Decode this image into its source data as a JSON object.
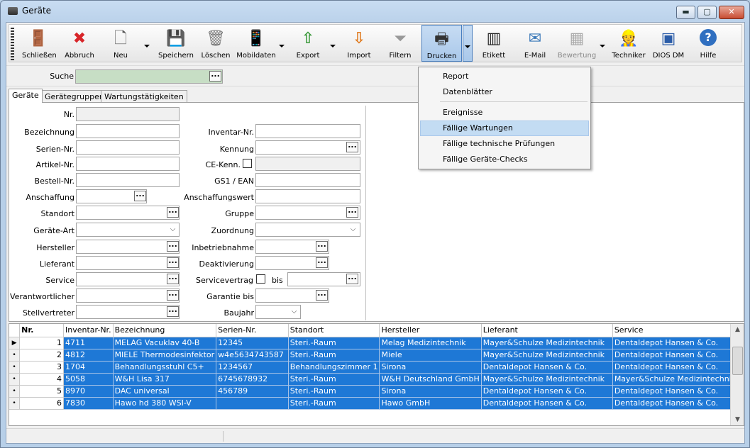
{
  "window": {
    "title": "Geräte",
    "controls": {
      "minimize": "▬",
      "maximize": "▢",
      "close": "✕"
    }
  },
  "toolbar": [
    {
      "id": "schliessen",
      "label": "Schließen",
      "icon": "door-exit-icon",
      "glyph": "🚪"
    },
    {
      "id": "abbruch",
      "label": "Abbruch",
      "icon": "cancel-icon",
      "glyph": "✖"
    },
    {
      "id": "neu",
      "label": "Neu",
      "icon": "new-document-icon",
      "glyph": "🗋"
    },
    {
      "id": "speichern",
      "label": "Speichern",
      "icon": "save-icon",
      "glyph": "💾"
    },
    {
      "id": "loeschen",
      "label": "Löschen",
      "icon": "trash-icon",
      "glyph": "🗑"
    },
    {
      "id": "mobildaten",
      "label": "Mobildaten",
      "icon": "mobile-device-icon",
      "glyph": "📱"
    },
    {
      "id": "export",
      "label": "Export",
      "icon": "export-arrow-icon",
      "glyph": "⇧"
    },
    {
      "id": "import",
      "label": "Import",
      "icon": "import-arrow-icon",
      "glyph": "⇩"
    },
    {
      "id": "filtern",
      "label": "Filtern",
      "icon": "filter-icon",
      "glyph": "⏷"
    },
    {
      "id": "drucken",
      "label": "Drucken",
      "icon": "printer-icon",
      "glyph": "🖶"
    },
    {
      "id": "etikett",
      "label": "Etikett",
      "icon": "barcode-label-icon",
      "glyph": "▥"
    },
    {
      "id": "email",
      "label": "E-Mail",
      "icon": "email-icon",
      "glyph": "✉"
    },
    {
      "id": "bewertung",
      "label": "Bewertung",
      "icon": "rating-chart-icon",
      "glyph": "▦"
    },
    {
      "id": "techniker",
      "label": "Techniker",
      "icon": "technician-icon",
      "glyph": "👷"
    },
    {
      "id": "diosdm",
      "label": "DIOS DM",
      "icon": "dios-dm-logo-icon",
      "glyph": "▣"
    },
    {
      "id": "hilfe",
      "label": "Hilfe",
      "icon": "help-icon",
      "glyph": "?"
    }
  ],
  "search": {
    "label": "Suche",
    "value": ""
  },
  "tabs": [
    "Geräte",
    "Gerätegruppen",
    "Wartungstätigkeiten"
  ],
  "form": {
    "left": [
      {
        "label": "Nr.",
        "value": ""
      },
      {
        "label": "Bezeichnung",
        "value": ""
      },
      {
        "label": "Serien-Nr.",
        "value": ""
      },
      {
        "label": "Artikel-Nr.",
        "value": ""
      },
      {
        "label": "Bestell-Nr.",
        "value": ""
      },
      {
        "label": "Anschaffung",
        "value": ""
      },
      {
        "label": "Standort",
        "value": ""
      },
      {
        "label": "Geräte-Art",
        "value": ""
      },
      {
        "label": "Hersteller",
        "value": ""
      },
      {
        "label": "Lieferant",
        "value": ""
      },
      {
        "label": "Service",
        "value": ""
      },
      {
        "label": "Verantwortlicher",
        "value": ""
      },
      {
        "label": "Stellvertreter",
        "value": ""
      }
    ],
    "right": [
      {
        "label": "Inventar-Nr.",
        "value": ""
      },
      {
        "label": "Kennung",
        "value": ""
      },
      {
        "label": "CE-Kenn.",
        "value": ""
      },
      {
        "label": "GS1 / EAN",
        "value": ""
      },
      {
        "label": "Anschaffungswert",
        "value": ""
      },
      {
        "label": "Gruppe",
        "value": ""
      },
      {
        "label": "Zuordnung",
        "value": ""
      },
      {
        "label": "Inbetriebnahme",
        "value": ""
      },
      {
        "label": "Deaktivierung",
        "value": ""
      },
      {
        "label": "Servicevertrag",
        "value": ""
      },
      {
        "label": "Garantie bis",
        "value": ""
      },
      {
        "label": "Baujahr",
        "value": ""
      }
    ],
    "bis_label": "bis"
  },
  "grid": {
    "columns": [
      "Nr.",
      "Inventar-Nr.",
      "Bezeichnung",
      "Serien-Nr.",
      "Standort",
      "Hersteller",
      "Lieferant",
      "Service"
    ],
    "rows": [
      {
        "indicator": "▶",
        "nr": "1",
        "inv": "4711",
        "bez": "MELAG Vacuklav 40-B",
        "ser": "12345",
        "std": "Steri.-Raum",
        "her": "Melag Medizintechnik",
        "lief": "Mayer&Schulze Medizintechnik",
        "serv": "Dentaldepot Hansen & Co."
      },
      {
        "indicator": "•",
        "nr": "2",
        "inv": "4812",
        "bez": "MIELE Thermodesinfektor",
        "ser": "w4e5634743587",
        "std": "Steri.-Raum",
        "her": "Miele",
        "lief": "Mayer&Schulze Medizintechnik",
        "serv": "Dentaldepot Hansen & Co."
      },
      {
        "indicator": "•",
        "nr": "3",
        "inv": "1704",
        "bez": "Behandlungsstuhl C5+",
        "ser": "1234567",
        "std": "Behandlungszimmer 1",
        "her": "Sirona",
        "lief": "Dentaldepot Hansen & Co.",
        "serv": "Dentaldepot Hansen & Co."
      },
      {
        "indicator": "•",
        "nr": "4",
        "inv": "5058",
        "bez": "W&H Lisa 317",
        "ser": "6745678932",
        "std": "Steri.-Raum",
        "her": "W&H Deutschland GmbH",
        "lief": "Mayer&Schulze Medizintechnik",
        "serv": "Mayer&Schulze Medizintechnik"
      },
      {
        "indicator": "•",
        "nr": "5",
        "inv": "8970",
        "bez": "DAC universal",
        "ser": "456789",
        "std": "Steri.-Raum",
        "her": "Sirona",
        "lief": "Dentaldepot Hansen & Co.",
        "serv": "Dentaldepot Hansen & Co."
      },
      {
        "indicator": "•",
        "nr": "6",
        "inv": "7830",
        "bez": "Hawo hd 380 WSI-V",
        "ser": "",
        "std": "Steri.-Raum",
        "her": "Hawo GmbH",
        "lief": "Dentaldepot Hansen & Co.",
        "serv": "Dentaldepot Hansen & Co."
      }
    ]
  },
  "print_menu": {
    "items": [
      "Report",
      "Datenblätter",
      "Ereignisse",
      "Fällige Wartungen",
      "Fällige technische Prüfungen",
      "Fällige Geräte-Checks"
    ],
    "hovered": "Fällige Wartungen"
  },
  "colors": {
    "selection": "#1e78d6",
    "search_bg": "#c7dec5",
    "menu_hover": "#c3dcf3"
  }
}
